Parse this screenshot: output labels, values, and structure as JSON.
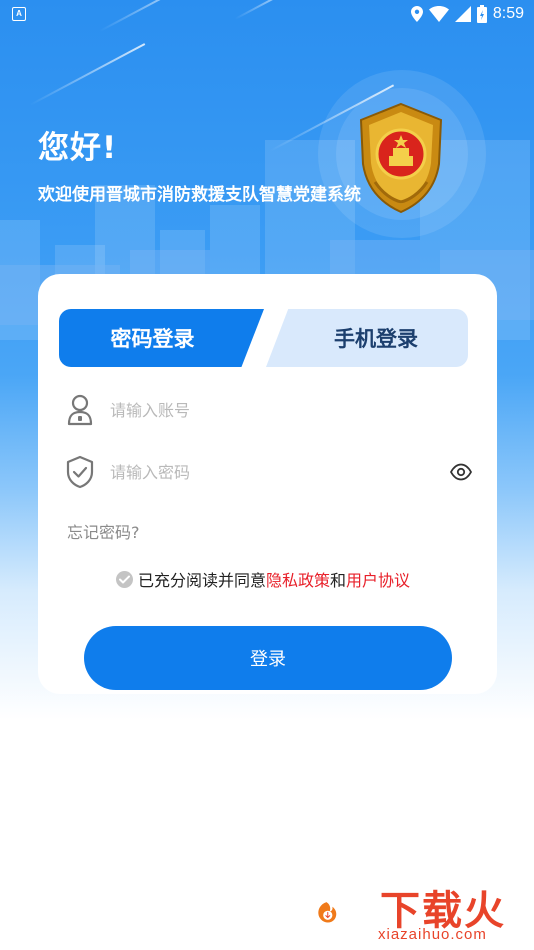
{
  "status_bar": {
    "time": "8:59",
    "app_indicator": "A"
  },
  "header": {
    "greeting": "您好!",
    "welcome": "欢迎使用晋城市消防救援支队智慧党建系统"
  },
  "tabs": [
    {
      "label": "密码登录",
      "active": true
    },
    {
      "label": "手机登录",
      "active": false
    }
  ],
  "form": {
    "account_placeholder": "请输入账号",
    "password_placeholder": "请输入密码",
    "forgot": "忘记密码?"
  },
  "agreement": {
    "prefix": "已充分阅读并同意",
    "privacy": "隐私政策",
    "and": "和",
    "user": "用户协议"
  },
  "login_button": "登录",
  "watermark": {
    "title": "下载火",
    "site": "xiazaihuo.com"
  },
  "colors": {
    "primary": "#0f7dec",
    "link": "#e8202a",
    "tab_inactive": "#d9e9fc"
  }
}
